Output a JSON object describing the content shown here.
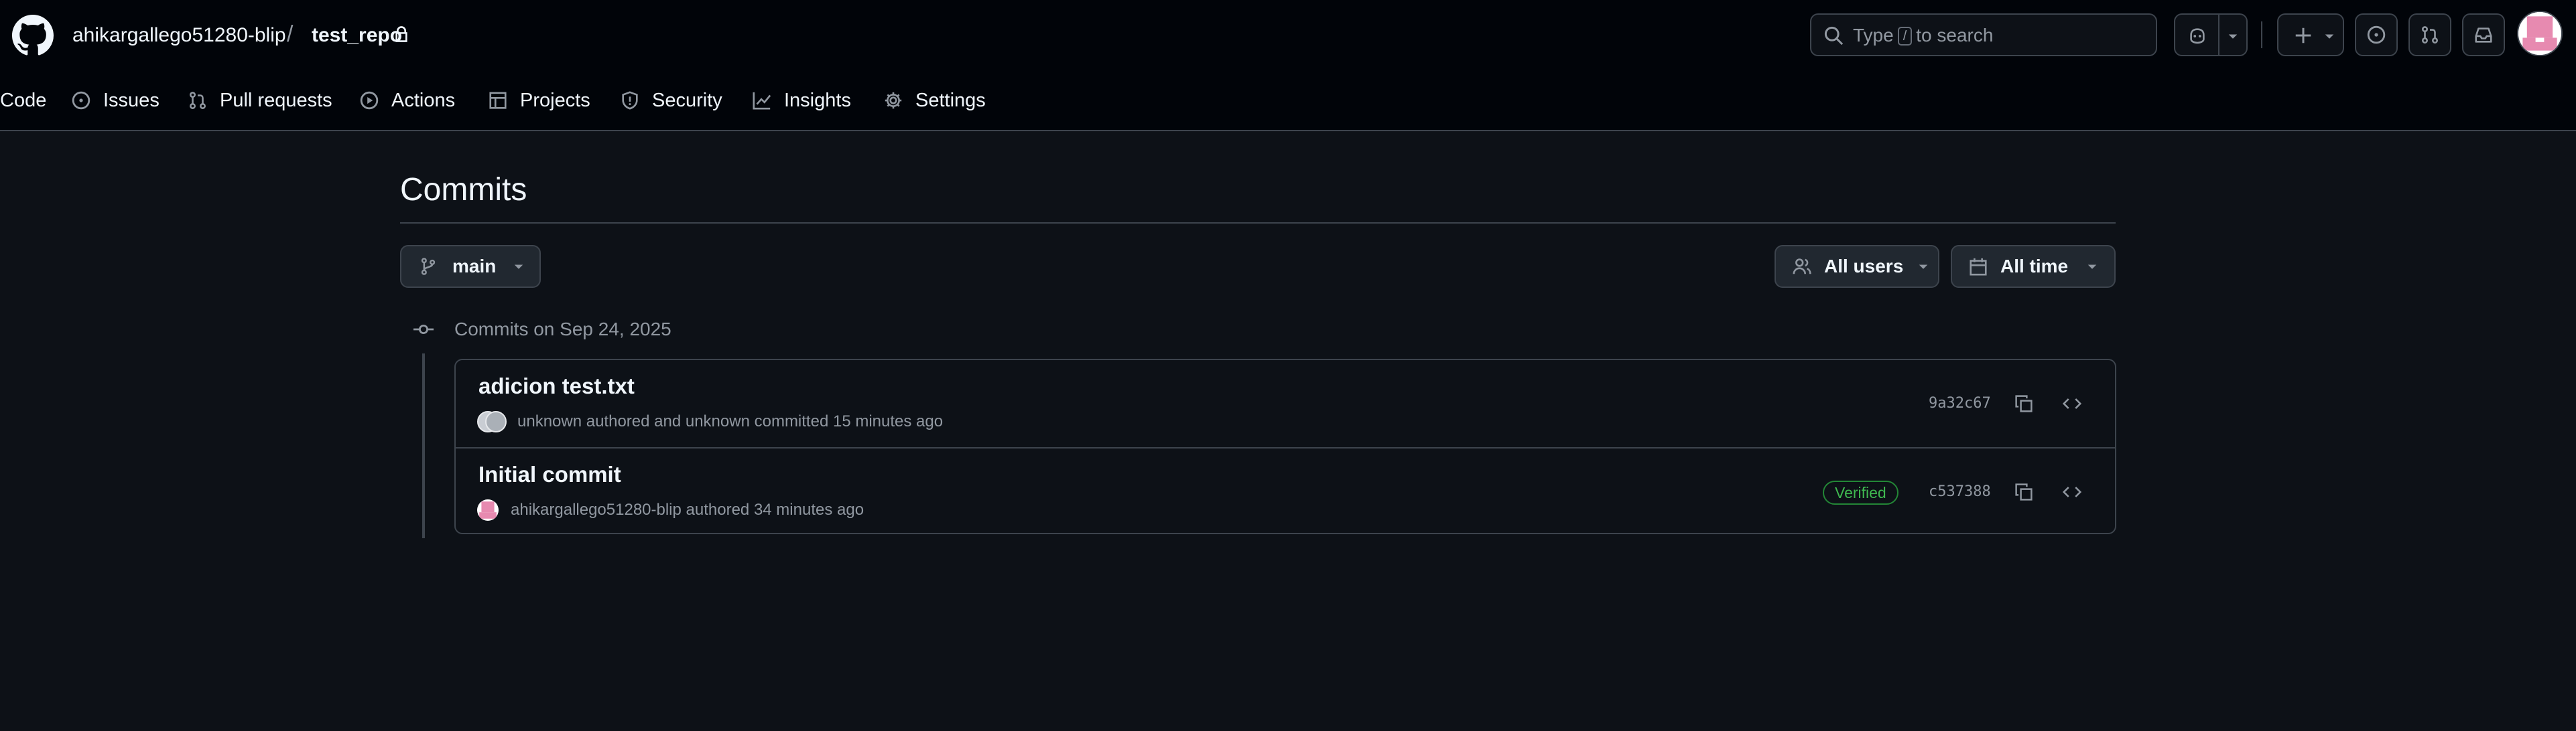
{
  "header": {
    "owner": "ahikargallego51280-blip",
    "separator": "/",
    "repo": "test_repo",
    "search": {
      "before": "Type",
      "key": "/",
      "after": "to search"
    }
  },
  "nav": [
    {
      "label": "Code",
      "icon": "code-icon"
    },
    {
      "label": "Issues",
      "icon": "issue-opened-icon"
    },
    {
      "label": "Pull requests",
      "icon": "git-pull-request-icon"
    },
    {
      "label": "Actions",
      "icon": "play-icon"
    },
    {
      "label": "Projects",
      "icon": "table-icon"
    },
    {
      "label": "Security",
      "icon": "shield-icon"
    },
    {
      "label": "Insights",
      "icon": "graph-icon"
    },
    {
      "label": "Settings",
      "icon": "gear-icon"
    }
  ],
  "page": {
    "title": "Commits",
    "branch": "main",
    "users_filter": "All users",
    "time_filter": "All time"
  },
  "groups": [
    {
      "title": "Commits on Sep 24, 2025",
      "commits": [
        {
          "message": "adicion test.txt",
          "meta": "unknown authored and unknown committed 15 minutes ago",
          "verified": "",
          "sha": "9a32c67"
        },
        {
          "message": "Initial commit",
          "meta": "ahikargallego51280-blip authored 34 minutes ago",
          "verified": "Verified",
          "sha": "c537388"
        }
      ]
    }
  ],
  "colors": {
    "background": "#0d1117",
    "header_bg": "#010409",
    "border": "#3d444d",
    "text": "#f0f6fc",
    "muted": "#9198a1",
    "verified": "#3fb950",
    "avatar_pink": "#e78ab0"
  }
}
